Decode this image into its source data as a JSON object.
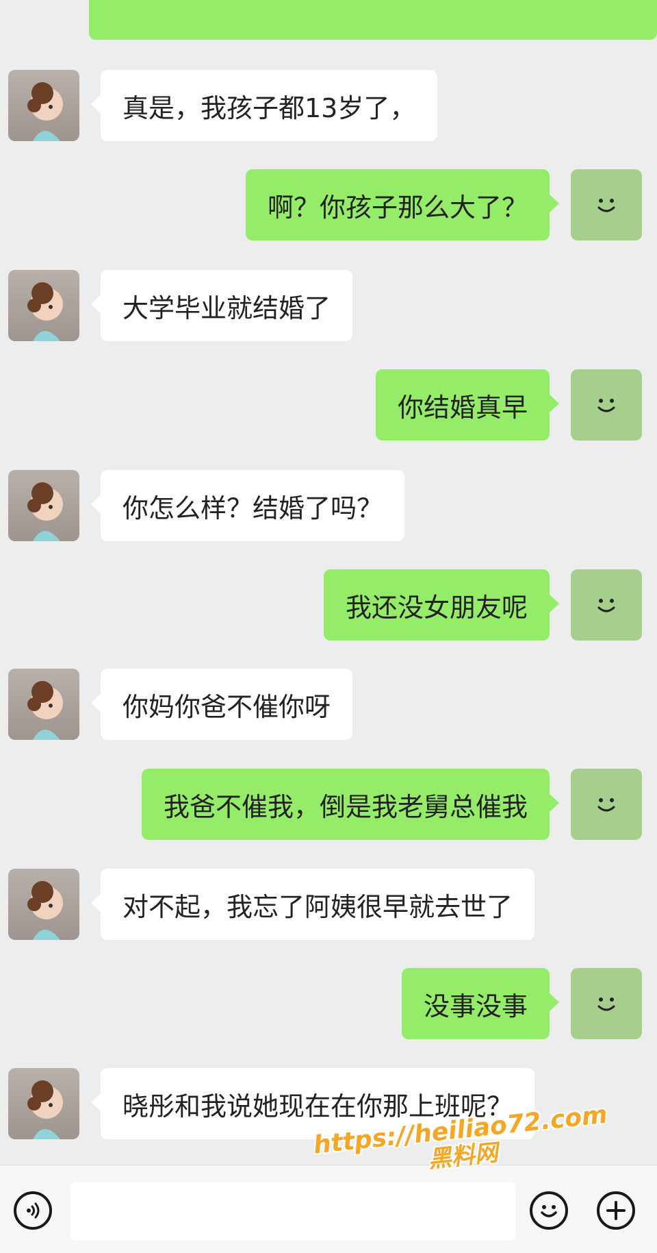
{
  "conversation": {
    "messages": [
      {
        "side": "left",
        "text": "真是，我孩子都13岁了，"
      },
      {
        "side": "right",
        "text": "啊？你孩子那么大了？"
      },
      {
        "side": "left",
        "text": "大学毕业就结婚了"
      },
      {
        "side": "right",
        "text": "你结婚真早"
      },
      {
        "side": "left",
        "text": "你怎么样？结婚了吗？"
      },
      {
        "side": "right",
        "text": "我还没女朋友呢"
      },
      {
        "side": "left",
        "text": "你妈你爸不催你呀"
      },
      {
        "side": "right",
        "text": "我爸不催我，倒是我老舅总催我"
      },
      {
        "side": "left",
        "text": "对不起，我忘了阿姨很早就去世了"
      },
      {
        "side": "right",
        "text": "没事没事"
      },
      {
        "side": "left",
        "text": "晓彤和我说她现在在你那上班呢？"
      }
    ]
  },
  "input_bar": {
    "voice_icon": "voice-icon",
    "emoji_icon": "smile-emoji-icon",
    "add_icon": "plus-icon",
    "text_value": ""
  },
  "watermark": {
    "url": "https://heiliao72.com",
    "name": "黑料网"
  },
  "colors": {
    "background": "#ededed",
    "sent_bubble": "#95ec69",
    "received_bubble": "#ffffff",
    "watermark": "#f5a623"
  }
}
